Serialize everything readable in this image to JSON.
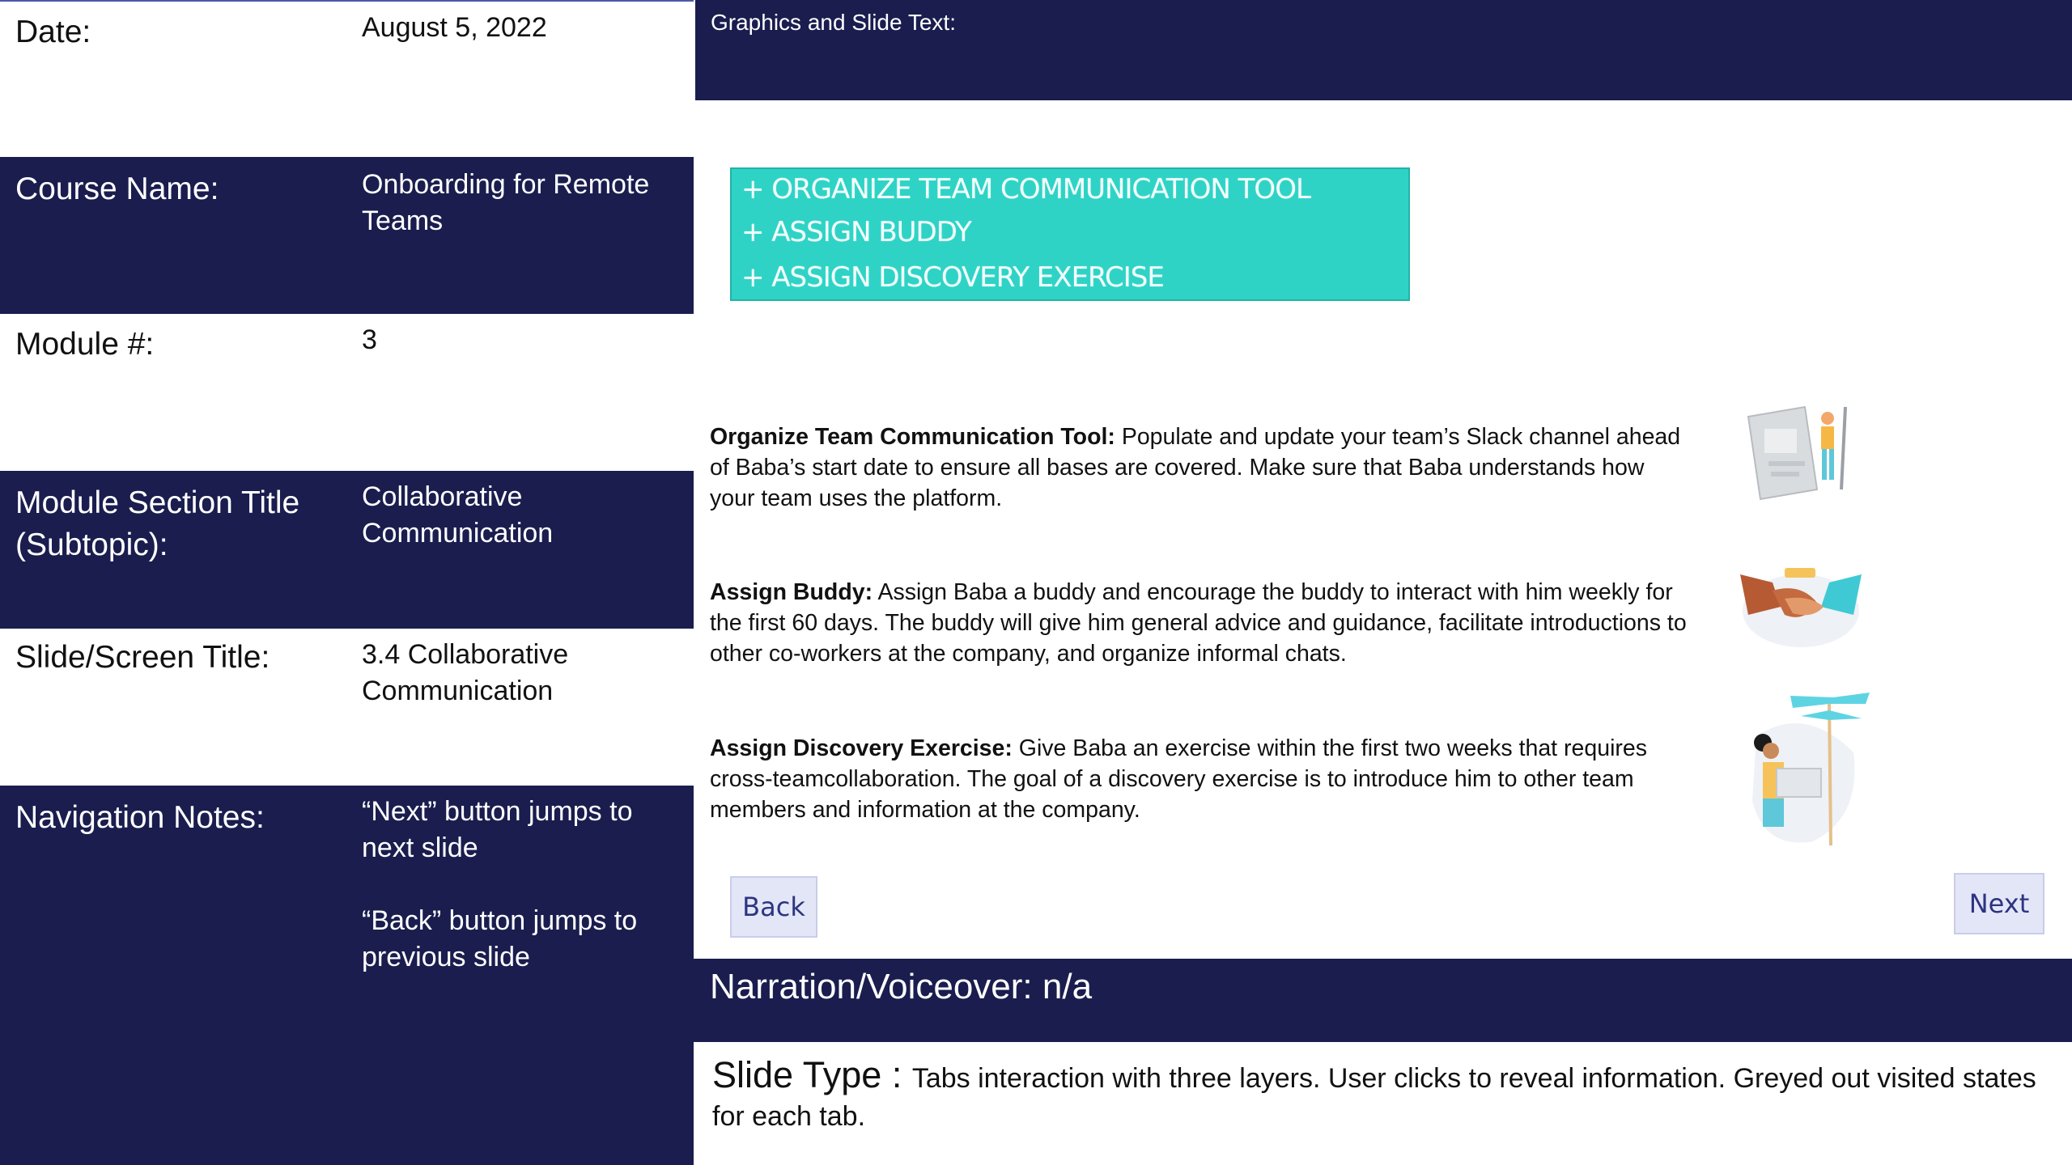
{
  "left": {
    "date": {
      "label": "Date:",
      "value": "August 5, 2022"
    },
    "course": {
      "label": "Course Name:",
      "value": "Onboarding for Remote Teams"
    },
    "module": {
      "label": "Module #:",
      "value": "3"
    },
    "section": {
      "label": "Module Section Title (Subtopic):",
      "value": "Collaborative Communication"
    },
    "slide_title": {
      "label": "Slide/Screen Title:",
      "value": "3.4 Collaborative Communication"
    },
    "navigation": {
      "label": "Navigation Notes:",
      "note1": "“Next” button jumps to next slide",
      "note2": "“Back” button jumps to previous slide"
    }
  },
  "header": {
    "title": "Graphics and Slide Text:"
  },
  "tabs": [
    "+ ORGANIZE TEAM COMMUNICATION TOOL",
    "+ ASSIGN BUDDY",
    "+ ASSIGN DISCOVERY EXERCISE"
  ],
  "items": [
    {
      "title": "Organize Team Communication Tool:",
      "body": " Populate and update your team’s Slack channel ahead of Baba’s start date to ensure all bases are covered. Make sure that Baba understands how your team uses the platform.",
      "icon": "document-person-icon"
    },
    {
      "title": "Assign Buddy:",
      "body": " Assign Baba a buddy and encourage the buddy to  interact with him weekly for the first 60 days. The buddy will give him general advice and guidance, facilitate introductions to other co-workers at the company, and organize informal chats.",
      "icon": "handshake-icon"
    },
    {
      "title": "Assign Discovery Exercise:",
      "body": " Give Baba an exercise within the first two weeks that requires cross-teamcollaboration. The goal of a discovery exercise is to introduce him to other team members and information at the company.",
      "icon": "signpost-person-icon"
    }
  ],
  "buttons": {
    "back": "Back",
    "next": "Next"
  },
  "narration": "Narration/Voiceover: n/a",
  "slide_type": {
    "label": "Slide Type : ",
    "text": "Tabs interaction with three layers. User clicks to reveal information. Greyed out visited states for each tab."
  },
  "colors": {
    "navy": "#1a1d4e",
    "teal": "#2fd3c6",
    "button": "#e3e6f7"
  }
}
